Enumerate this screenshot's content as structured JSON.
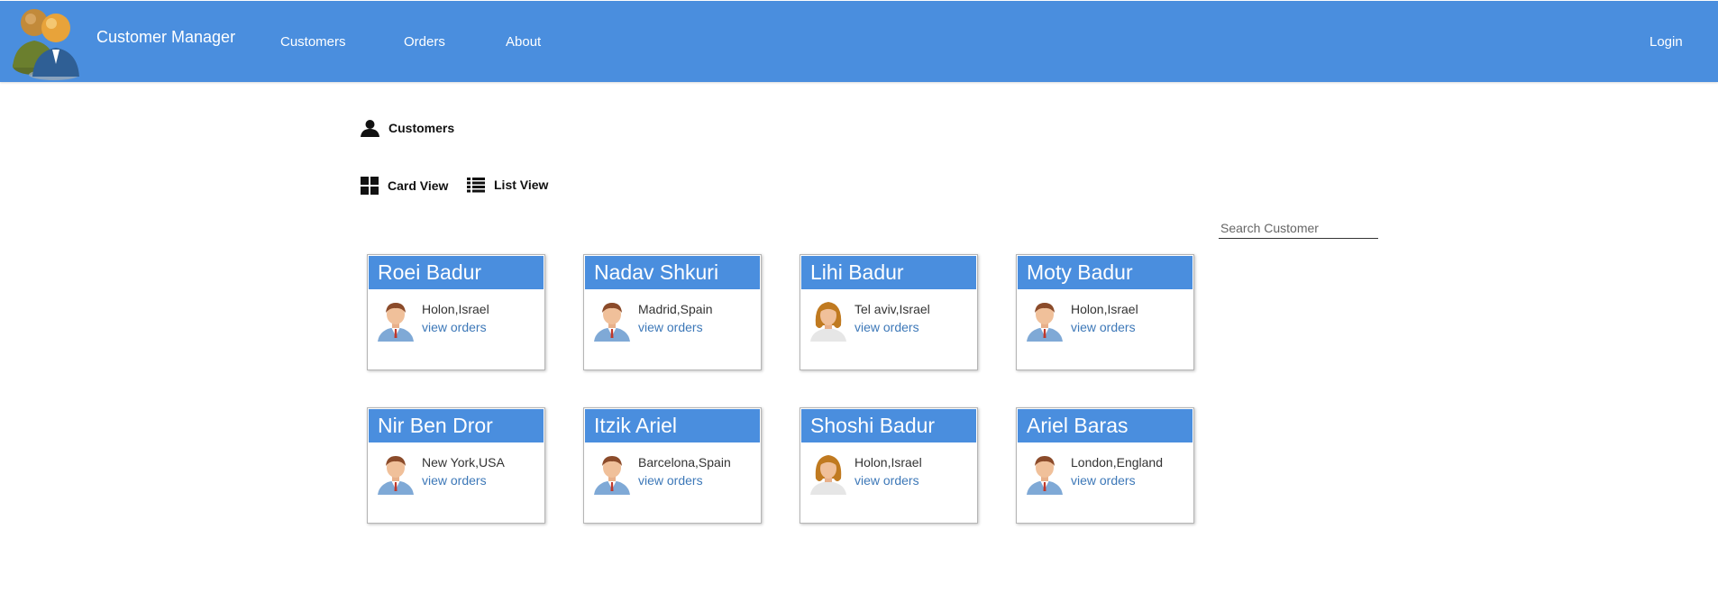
{
  "navbar": {
    "app_title": "Customer Manager",
    "links": [
      "Customers",
      "Orders",
      "About"
    ],
    "login_label": "Login"
  },
  "page": {
    "section_title": "Customers",
    "card_view_label": "Card View",
    "list_view_label": "List View",
    "search_placeholder": "Search Customer"
  },
  "customers": [
    {
      "name": "Roei Badur",
      "location": "Holon,Israel",
      "link": "view orders",
      "avatar": "male-avatar-icon"
    },
    {
      "name": "Nadav Shkuri",
      "location": "Madrid,Spain",
      "link": "view orders",
      "avatar": "male-avatar-icon"
    },
    {
      "name": "Lihi Badur",
      "location": "Tel aviv,Israel",
      "link": "view orders",
      "avatar": "female-avatar-icon"
    },
    {
      "name": "Moty Badur",
      "location": "Holon,Israel",
      "link": "view orders",
      "avatar": "male-avatar-icon"
    },
    {
      "name": "Nir Ben Dror",
      "location": "New York,USA",
      "link": "view orders",
      "avatar": "male-avatar-icon"
    },
    {
      "name": "Itzik Ariel",
      "location": "Barcelona,Spain",
      "link": "view orders",
      "avatar": "male-avatar-icon"
    },
    {
      "name": "Shoshi Badur",
      "location": "Holon,Israel",
      "link": "view orders",
      "avatar": "female-avatar-icon"
    },
    {
      "name": "Ariel Baras",
      "location": "London,England",
      "link": "view orders",
      "avatar": "male-avatar-icon"
    }
  ],
  "colors": {
    "primary": "#4a8ede",
    "link": "#3d78b8"
  }
}
